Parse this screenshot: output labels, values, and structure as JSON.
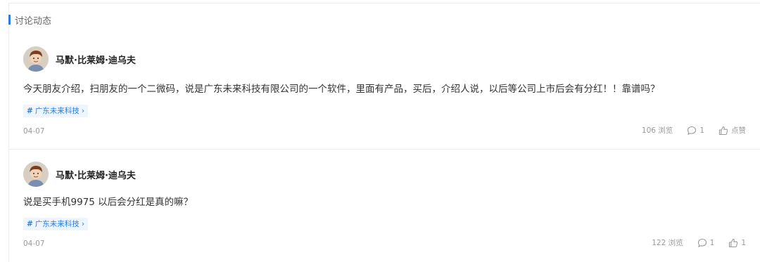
{
  "section": {
    "title": "讨论动态",
    "accent_color": "#2a7de1"
  },
  "posts": [
    {
      "author": "马默·比莱姆·迪乌夫",
      "content": "今天朋友介绍，扫朋友的一个二微码，说是广东未来科技有限公司的一个软件，里面有产品，买后，介绍人说，以后等公司上市后会有分红！！靠谱吗？",
      "tag": "广东未来科技",
      "date": "04-07",
      "views": "106 浏览",
      "comments": "1",
      "likes": "点赞"
    },
    {
      "author": "马默·比莱姆·迪乌夫",
      "content": "说是买手机9975 以后会分红是真的嘛？",
      "tag": "广东未来科技",
      "date": "04-07",
      "views": "122 浏览",
      "comments": "1",
      "likes": "1"
    }
  ],
  "icons": {
    "tag": "hash-icon",
    "tag_chevron": "chevron-right-icon",
    "comment": "comment-icon",
    "like": "thumbs-up-icon",
    "avatar": "avatar-cartoon"
  }
}
